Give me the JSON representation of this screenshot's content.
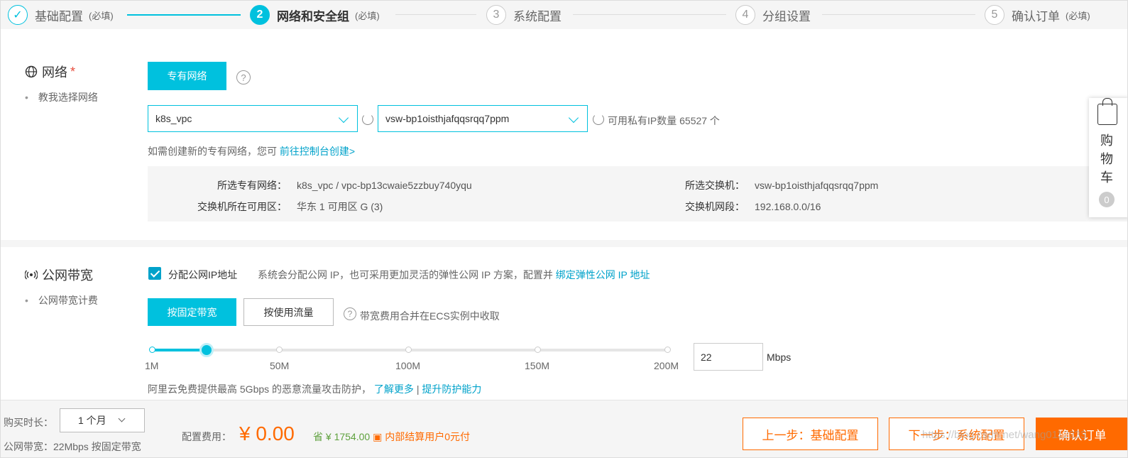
{
  "steps": [
    {
      "num": "✓",
      "label": "基础配置",
      "req": "(必填)",
      "state": "done"
    },
    {
      "num": "2",
      "label": "网络和安全组",
      "req": "(必填)",
      "state": "active"
    },
    {
      "num": "3",
      "label": "系统配置",
      "req": "",
      "state": "todo"
    },
    {
      "num": "4",
      "label": "分组设置",
      "req": "",
      "state": "todo"
    },
    {
      "num": "5",
      "label": "确认订单",
      "req": "(必填)",
      "state": "todo"
    }
  ],
  "network": {
    "title": "网络",
    "star": "*",
    "sub": "教我选择网络",
    "type_btn": "专有网络",
    "help": "?",
    "vpc_value": "k8s_vpc",
    "vswitch_value": "vsw-bp1oisthjafqqsrqq7ppm",
    "ip_count": "可用私有IP数量 65527 个",
    "create_hint": "如需创建新的专有网络，您可",
    "create_link": "前往控制台创建>",
    "info": {
      "vpc_key": "所选专有网络：",
      "vpc_val": "k8s_vpc / vpc-bp13cwaie5zzbuy740yqu",
      "zone_key": "交换机所在可用区：",
      "zone_val": "华东 1 可用区 G (3)",
      "vsw_key": "所选交换机：",
      "vsw_val": "vsw-bp1oisthjafqqsrqq7ppm",
      "cidr_key": "交换机网段：",
      "cidr_val": "192.168.0.0/16"
    }
  },
  "bandwidth": {
    "title": "公网带宽",
    "sub": "公网带宽计费",
    "assign_label": "分配公网IP地址",
    "assign_desc": "系统会分配公网 IP，也可采用更加灵活的弹性公网 IP 方案，配置并",
    "assign_link": "绑定弹性公网 IP 地址",
    "fixed_btn": "按固定带宽",
    "traffic_btn": "按使用流量",
    "fee_note": "带宽费用合并在ECS实例中收取",
    "ticks": [
      "1M",
      "50M",
      "100M",
      "150M",
      "200M"
    ],
    "value": "22",
    "value_num": 22,
    "max": 200,
    "unit": "Mbps",
    "ddos_text": "阿里云免费提供最高 5Gbps 的恶意流量攻击防护，",
    "ddos_link1": "了解更多",
    "ddos_sep": "|",
    "ddos_link2": "提升防护能力"
  },
  "cart": {
    "chars": [
      "购",
      "物",
      "车"
    ],
    "count": "0"
  },
  "footer": {
    "duration_label": "购买时长：",
    "duration_value": "1 个月",
    "bw_summary": "公网带宽：22Mbps 按固定带宽",
    "fee_label": "配置费用：",
    "price": "¥ 0.00",
    "save_icon": "省",
    "save_amount": "¥ 1754.00",
    "internal": "内部结算用户0元付",
    "prev_btn": "上一步：基础配置",
    "next_btn": "下一步：系统配置",
    "confirm_btn": "确认订单",
    "watermark": "https://blog.csdn.net/wang0112233"
  }
}
